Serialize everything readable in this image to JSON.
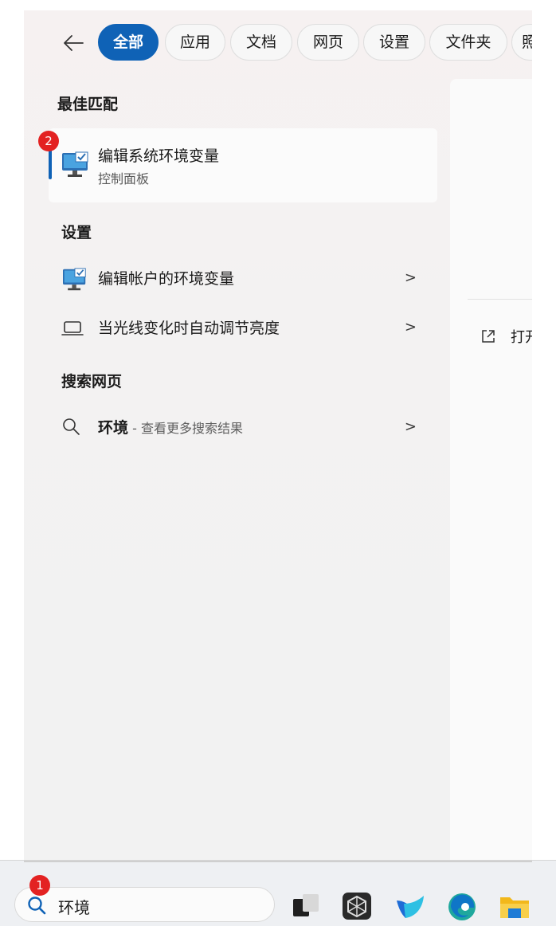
{
  "tabs": {
    "all": "全部",
    "apps": "应用",
    "docs": "文档",
    "web": "网页",
    "settings": "设置",
    "folders": "文件夹",
    "more": "照"
  },
  "best_match": {
    "heading": "最佳匹配",
    "title": "编辑系统环境变量",
    "subtitle": "控制面板"
  },
  "settings_section": {
    "heading": "设置",
    "items": [
      {
        "label": "编辑帐户的环境变量"
      },
      {
        "label": "当光线变化时自动调节亮度"
      }
    ]
  },
  "web_section": {
    "heading": "搜索网页",
    "query": "环境",
    "suffix": " - 查看更多搜索结果"
  },
  "right_pane": {
    "open_label": "打开"
  },
  "search": {
    "value": "环境"
  },
  "badges": {
    "one": "1",
    "two": "2"
  },
  "colors": {
    "accent": "#0f62b6",
    "badge": "#e32222"
  }
}
